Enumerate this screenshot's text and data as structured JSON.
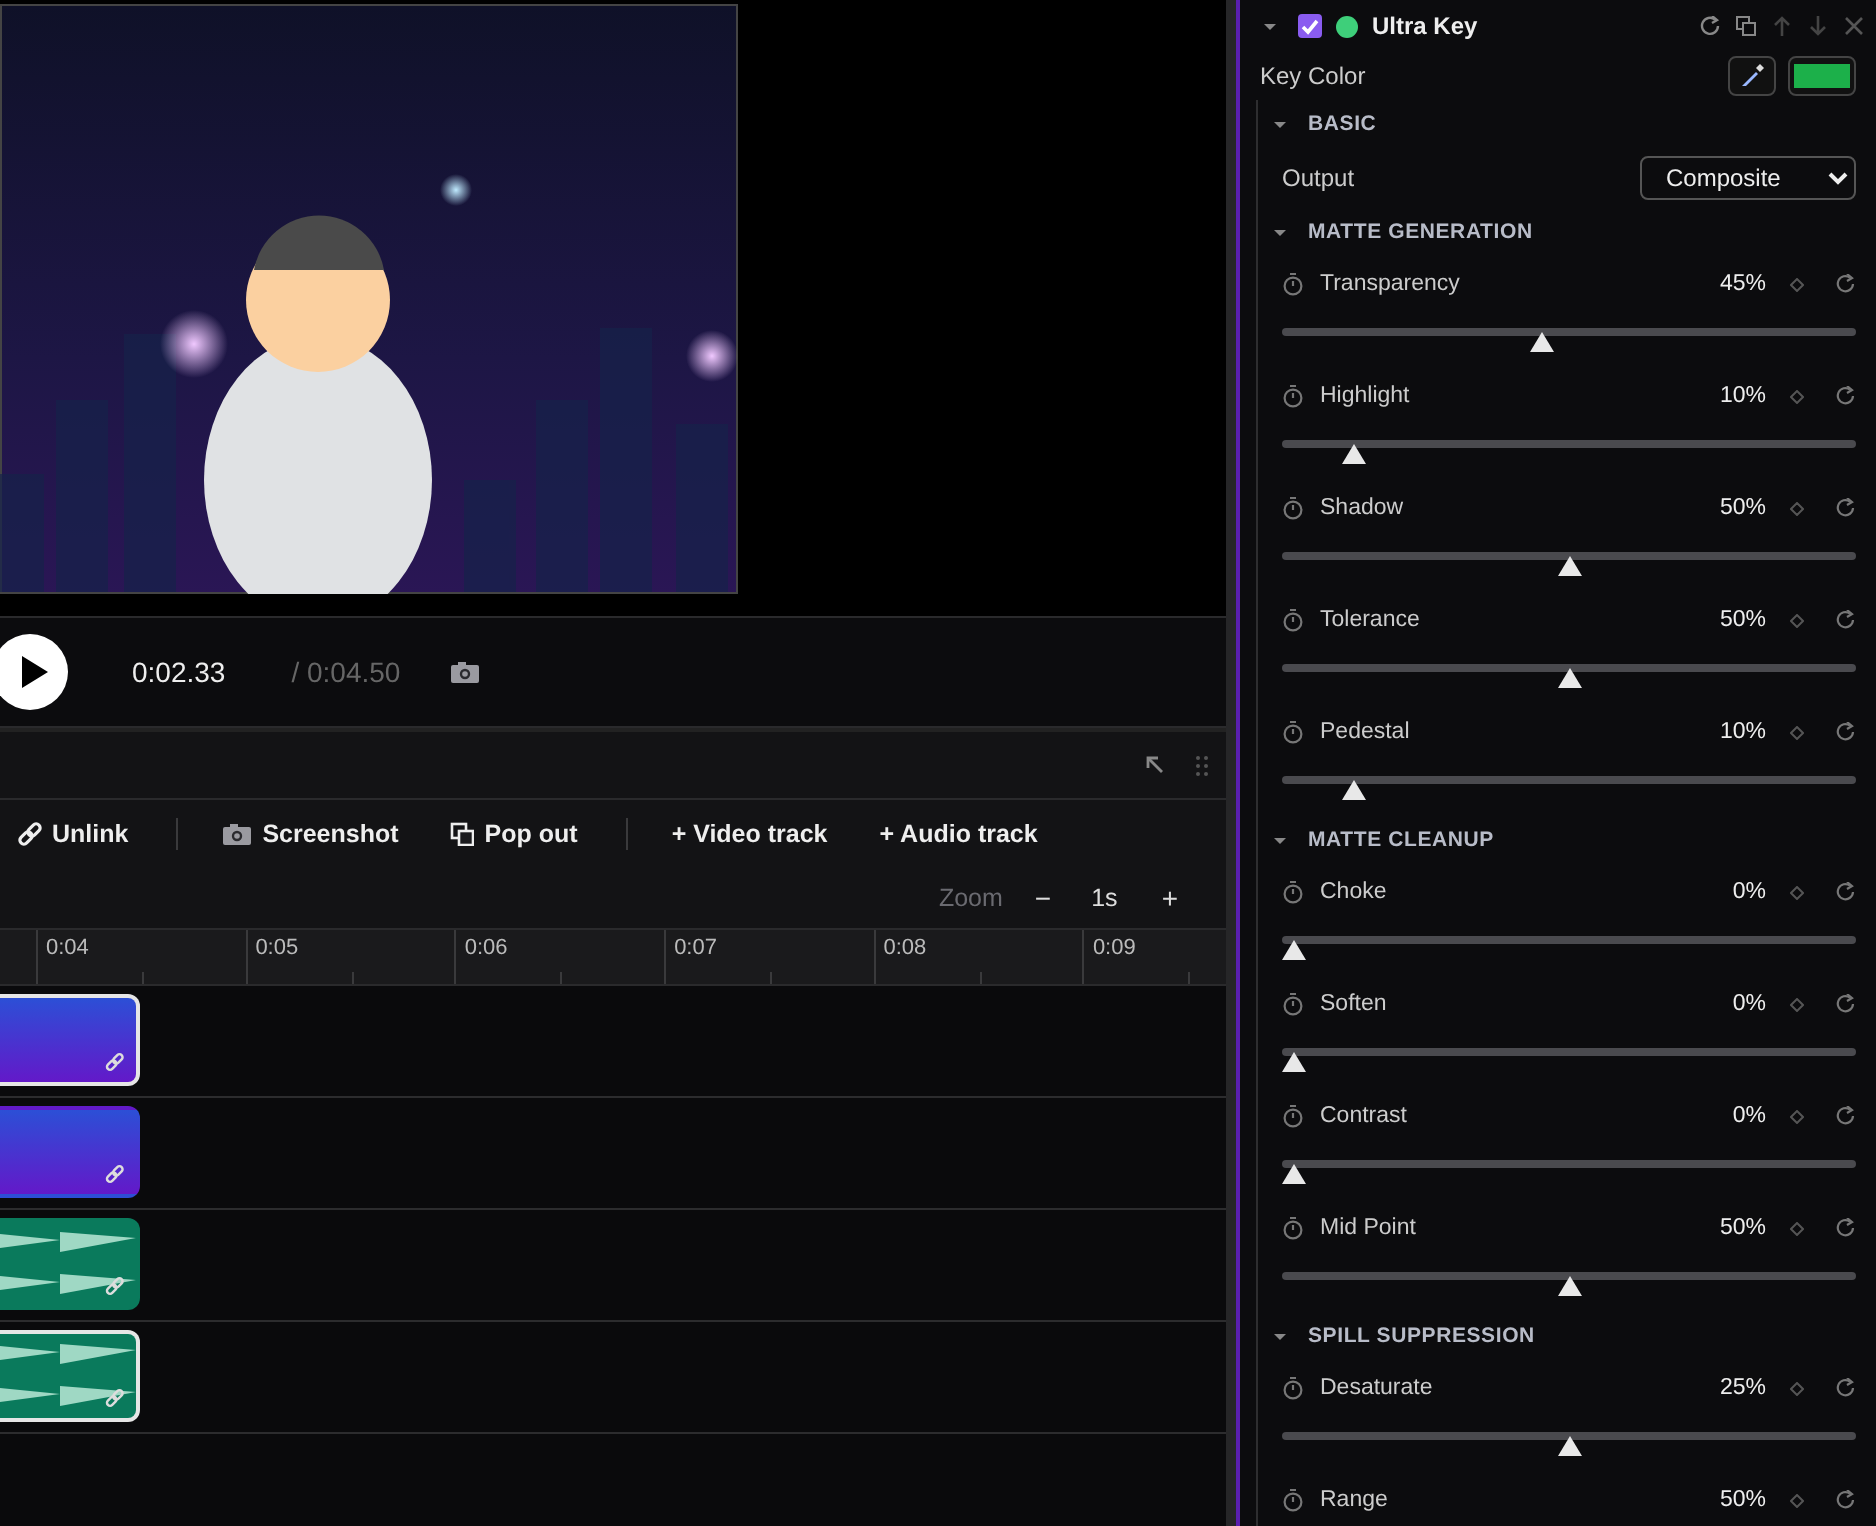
{
  "preview": {
    "current_time": "0:02.33",
    "total_time": "/ 0:04.50"
  },
  "timeline": {
    "toolbar": [
      {
        "kind": "unlink",
        "label": "Unlink"
      },
      {
        "kind": "separator"
      },
      {
        "kind": "screenshot",
        "label": "Screenshot"
      },
      {
        "kind": "popout",
        "label": "Pop out"
      },
      {
        "kind": "separator"
      },
      {
        "kind": "add",
        "label": "+ Video track"
      },
      {
        "kind": "add",
        "label": "+ Audio track"
      }
    ],
    "zoom": {
      "label": "Zoom",
      "decrease": "−",
      "value": "1s",
      "increase": "+"
    },
    "ruler": [
      "0:04",
      "0:05",
      "0:06",
      "0:07",
      "0:08",
      "0:09"
    ],
    "tracks": [
      {
        "kind": "video",
        "selected": true
      },
      {
        "kind": "video",
        "selected": false
      },
      {
        "kind": "audio",
        "selected": false
      },
      {
        "kind": "audio",
        "selected": true
      }
    ]
  },
  "effect": {
    "title": "Ultra Key",
    "enabled": true,
    "key_color_label": "Key Color",
    "sections": [
      {
        "title": "BASIC",
        "rows": [
          {
            "kind": "select",
            "label": "Output",
            "value": "Composite"
          }
        ]
      },
      {
        "title": "MATTE GENERATION",
        "rows": [
          {
            "kind": "slider",
            "label": "Transparency",
            "value": "45%",
            "level": 0.45
          },
          {
            "kind": "slider",
            "label": "Highlight",
            "value": "10%",
            "level": 0.11
          },
          {
            "kind": "slider",
            "label": "Shadow",
            "value": "50%",
            "level": 0.5
          },
          {
            "kind": "slider",
            "label": "Tolerance",
            "value": "50%",
            "level": 0.5
          },
          {
            "kind": "slider",
            "label": "Pedestal",
            "value": "10%",
            "level": 0.11
          }
        ]
      },
      {
        "title": "MATTE CLEANUP",
        "rows": [
          {
            "kind": "slider",
            "label": "Choke",
            "value": "0%",
            "level": 0
          },
          {
            "kind": "slider",
            "label": "Soften",
            "value": "0%",
            "level": 0
          },
          {
            "kind": "slider",
            "label": "Contrast",
            "value": "0%",
            "level": 0
          },
          {
            "kind": "slider",
            "label": "Mid Point",
            "value": "50%",
            "level": 0.5
          }
        ]
      },
      {
        "title": "SPILL SUPPRESSION",
        "rows": [
          {
            "kind": "slider",
            "label": "Desaturate",
            "value": "25%",
            "level": 0.5
          },
          {
            "kind": "slider",
            "label": "Range",
            "value": "50%"
          }
        ]
      }
    ]
  }
}
